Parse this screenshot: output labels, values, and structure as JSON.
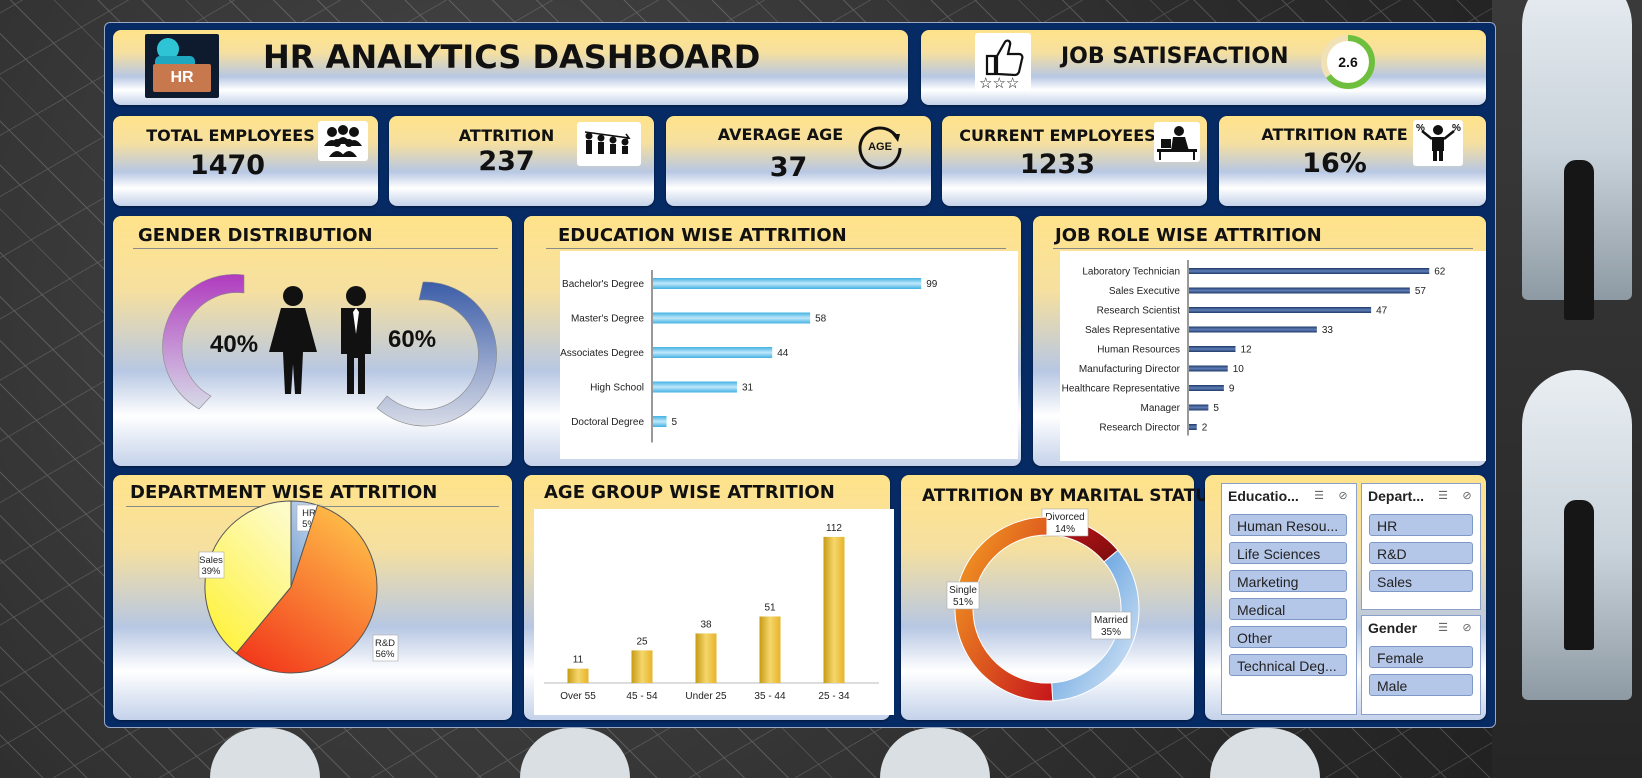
{
  "header": {
    "hr_badge": "HR",
    "title": "HR ANALYTICS DASHBOARD"
  },
  "job_satisfaction": {
    "label": "JOB SATISFACTION",
    "value": "2.6",
    "fraction": 0.65
  },
  "kpis": [
    {
      "label": "TOTAL EMPLOYEES",
      "value": "1470",
      "icon": "people-group-icon"
    },
    {
      "label": "ATTRITION",
      "value": "237",
      "icon": "people-leaving-icon"
    },
    {
      "label": "AVERAGE AGE",
      "value": "37",
      "icon": "age-icon",
      "icon_text": "AGE"
    },
    {
      "label": "CURRENT EMPLOYEES",
      "value": "1233",
      "icon": "employee-desk-icon"
    },
    {
      "label": "ATTRITION RATE",
      "value": "16%",
      "icon": "percent-person-icon"
    }
  ],
  "gender": {
    "title": "GENDER DISTRIBUTION",
    "female_pct": "40%",
    "male_pct": "60%"
  },
  "colors": {
    "navy": "#062a63",
    "bar_blue": "#43b1e3",
    "bar_navy": "#1f3a68",
    "bar_gold": "#e6b42a",
    "pie_yellow": "#fff23a",
    "pie_red": "#f23a1c",
    "pie_blue": "#7aa3d3",
    "donut_orange": "#f6a623",
    "donut_red": "#c6151b",
    "donut_blue": "#3a8ad8"
  },
  "chart_data": [
    {
      "id": "education",
      "type": "bar",
      "orientation": "horizontal",
      "title": "EDUCATION WISE ATTRITION",
      "categories": [
        "Bachelor's Degree",
        "Master's Degree",
        "Associates Degree",
        "High School",
        "Doctoral Degree"
      ],
      "values": [
        99,
        58,
        44,
        31,
        5
      ],
      "xlim": [
        0,
        110
      ]
    },
    {
      "id": "jobrole",
      "type": "bar",
      "orientation": "horizontal",
      "title": "JOB ROLE WISE ATTRITION",
      "categories": [
        "Laboratory Technician",
        "Sales Executive",
        "Research Scientist",
        "Sales Representative",
        "Human Resources",
        "Manufacturing Director",
        "Healthcare Representative",
        "Manager",
        "Research Director"
      ],
      "values": [
        62,
        57,
        47,
        33,
        12,
        10,
        9,
        5,
        2
      ],
      "xlim": [
        0,
        64
      ]
    },
    {
      "id": "department",
      "type": "pie",
      "title": "DEPARTMENT WISE ATTRITION",
      "categories": [
        "HR",
        "R&D",
        "Sales"
      ],
      "values": [
        5,
        56,
        39
      ],
      "labels": [
        "5%",
        "56%",
        "39%"
      ]
    },
    {
      "id": "agegroup",
      "type": "bar",
      "title": "AGE GROUP WISE ATTRITION",
      "categories": [
        "Over 55",
        "45 - 54",
        "Under 25",
        "35 - 44",
        "25 - 34"
      ],
      "values": [
        11,
        25,
        38,
        51,
        112
      ],
      "ylim": [
        0,
        115
      ]
    },
    {
      "id": "marital",
      "type": "pie",
      "subtype": "donut",
      "title": "ATTRITION BY MARITAL STATUS",
      "categories": [
        "Divorced",
        "Married",
        "Single"
      ],
      "values": [
        14,
        35,
        51
      ],
      "labels": [
        "14%",
        "35%",
        "51%"
      ]
    }
  ],
  "slicers": {
    "education": {
      "title": "Educatio...",
      "items": [
        "Human Resou...",
        "Life Sciences",
        "Marketing",
        "Medical",
        "Other",
        "Technical Deg..."
      ]
    },
    "department": {
      "title": "Depart...",
      "items": [
        "HR",
        "R&D",
        "Sales"
      ]
    },
    "gender": {
      "title": "Gender",
      "items": [
        "Female",
        "Male"
      ]
    }
  }
}
